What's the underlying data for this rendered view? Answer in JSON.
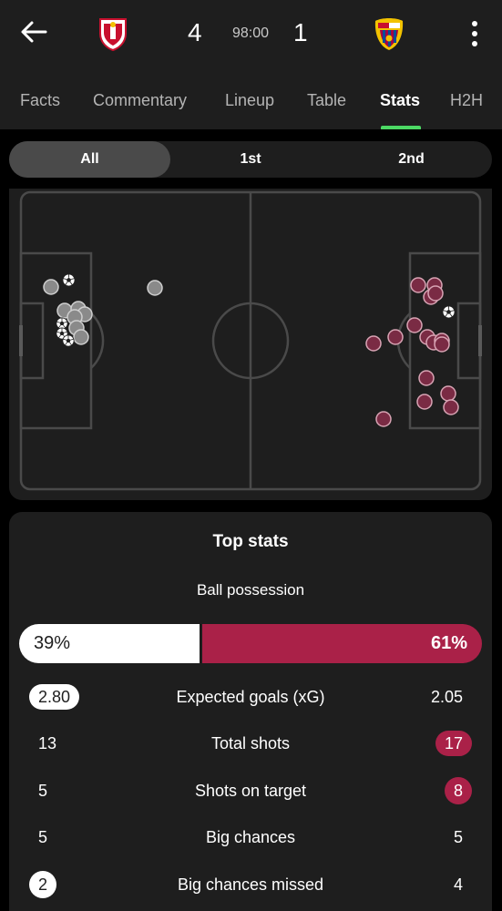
{
  "match": {
    "home_score": "4",
    "away_score": "1",
    "time": "98:00",
    "home_color": "#ffffff",
    "away_color": "#aa2148"
  },
  "header": {
    "back_icon": "arrow-left-icon",
    "more_icon": "more-vertical-icon"
  },
  "tabs": [
    {
      "label": "Facts"
    },
    {
      "label": "Commentary"
    },
    {
      "label": "Lineup"
    },
    {
      "label": "Table"
    },
    {
      "label": "Stats"
    },
    {
      "label": "H2H"
    }
  ],
  "active_tab": "Stats",
  "periods": [
    {
      "label": "All"
    },
    {
      "label": "1st"
    },
    {
      "label": "2nd"
    }
  ],
  "active_period": "All",
  "top_stats": {
    "title": "Top stats",
    "possession": {
      "label": "Ball possession",
      "home": "39%",
      "away": "61%",
      "home_fraction": 0.39
    },
    "rows": [
      {
        "label": "Expected goals (xG)",
        "home": "2.80",
        "away": "2.05",
        "highlight": "home"
      },
      {
        "label": "Total shots",
        "home": "13",
        "away": "17",
        "highlight": "away"
      },
      {
        "label": "Shots on target",
        "home": "5",
        "away": "8",
        "highlight": "away"
      },
      {
        "label": "Big chances",
        "home": "5",
        "away": "5",
        "highlight": "none"
      },
      {
        "label": "Big chances missed",
        "home": "2",
        "away": "4",
        "highlight": "home"
      }
    ]
  }
}
